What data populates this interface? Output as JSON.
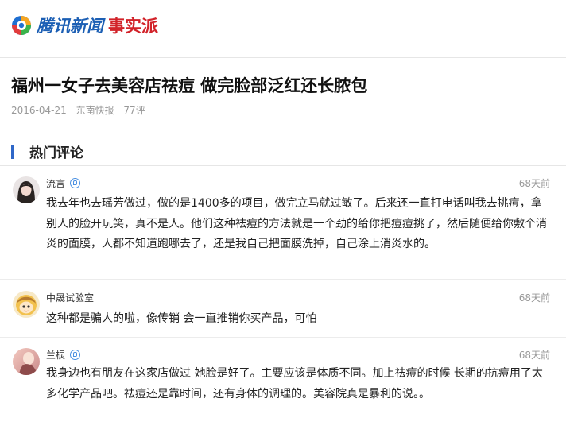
{
  "header": {
    "logo_text": "腾讯新闻",
    "column_tag": "事实派"
  },
  "article": {
    "title": "福州一女子去美容店祛痘 做完脸部泛红还长脓包",
    "date": "2016-04-21",
    "source": "东南快报",
    "comment_count": "77评"
  },
  "section": {
    "title": "热门评论"
  },
  "comments": [
    {
      "name": "流言",
      "verified": true,
      "time": "68天前",
      "text": "我去年也去瑶芳做过，做的是1400多的项目，做完立马就过敏了。后来还一直打电话叫我去挑痘，拿别人的脸开玩笑，真不是人。他们这种祛痘的方法就是一个劲的给你把痘痘挑了，然后随便给你敷个消炎的面膜，人都不知道跑哪去了，还是我自己把面膜洗掉，自己涂上消炎水的。"
    },
    {
      "name": "中晟试验室",
      "verified": false,
      "time": "68天前",
      "text": "这种都是骗人的啦，像传销 会一直推销你买产品，可怕"
    },
    {
      "name": "兰棂",
      "verified": true,
      "time": "68天前",
      "text": "我身边也有朋友在这家店做过 她脸是好了。主要应该是体质不同。加上祛痘的时候 长期的抗痘用了太多化学产品吧。祛痘还是靠时间，还有身体的调理的。美容院真是暴利的说。。"
    }
  ]
}
